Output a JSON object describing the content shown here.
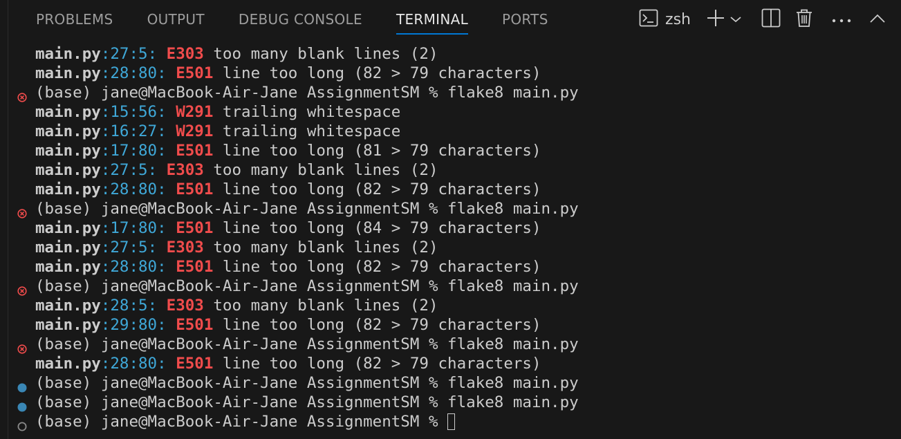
{
  "tabs": [
    {
      "label": "PROBLEMS",
      "active": false
    },
    {
      "label": "OUTPUT",
      "active": false
    },
    {
      "label": "DEBUG CONSOLE",
      "active": false
    },
    {
      "label": "TERMINAL",
      "active": true
    },
    {
      "label": "PORTS",
      "active": false
    }
  ],
  "actions": {
    "shell_label": "zsh",
    "icons": [
      "terminal-icon",
      "plus-icon",
      "chevron-down-icon",
      "split-icon",
      "trash-icon",
      "ellipsis-icon",
      "chevron-up-icon"
    ]
  },
  "colors": {
    "background": "#181818",
    "error_code": "#f14c4c",
    "location": "#3fa8d8",
    "tab_active_underline": "#0078d4",
    "decoration_error": "#f14c4c",
    "decoration_success": "#3a87b5",
    "decoration_default": "#8a8a8a"
  },
  "terminal": {
    "lines": [
      {
        "type": "lint",
        "file": "main.py",
        "loc": "27:5",
        "code": "E303",
        "msg": " too many blank lines (2)"
      },
      {
        "type": "lint",
        "file": "main.py",
        "loc": "28:80",
        "code": "E501",
        "msg": " line too long (82 > 79 characters)"
      },
      {
        "type": "prompt",
        "status": "error",
        "text": "(base) jane@MacBook-Air-Jane AssignmentSM % flake8 main.py"
      },
      {
        "type": "lint",
        "file": "main.py",
        "loc": "15:56",
        "code": "W291",
        "msg": " trailing whitespace"
      },
      {
        "type": "lint",
        "file": "main.py",
        "loc": "16:27",
        "code": "W291",
        "msg": " trailing whitespace"
      },
      {
        "type": "lint",
        "file": "main.py",
        "loc": "17:80",
        "code": "E501",
        "msg": " line too long (81 > 79 characters)"
      },
      {
        "type": "lint",
        "file": "main.py",
        "loc": "27:5",
        "code": "E303",
        "msg": " too many blank lines (2)"
      },
      {
        "type": "lint",
        "file": "main.py",
        "loc": "28:80",
        "code": "E501",
        "msg": " line too long (82 > 79 characters)"
      },
      {
        "type": "prompt",
        "status": "error",
        "text": "(base) jane@MacBook-Air-Jane AssignmentSM % flake8 main.py"
      },
      {
        "type": "lint",
        "file": "main.py",
        "loc": "17:80",
        "code": "E501",
        "msg": " line too long (84 > 79 characters)"
      },
      {
        "type": "lint",
        "file": "main.py",
        "loc": "27:5",
        "code": "E303",
        "msg": " too many blank lines (2)"
      },
      {
        "type": "lint",
        "file": "main.py",
        "loc": "28:80",
        "code": "E501",
        "msg": " line too long (82 > 79 characters)"
      },
      {
        "type": "prompt",
        "status": "error",
        "text": "(base) jane@MacBook-Air-Jane AssignmentSM % flake8 main.py"
      },
      {
        "type": "lint",
        "file": "main.py",
        "loc": "28:5",
        "code": "E303",
        "msg": " too many blank lines (2)"
      },
      {
        "type": "lint",
        "file": "main.py",
        "loc": "29:80",
        "code": "E501",
        "msg": " line too long (82 > 79 characters)"
      },
      {
        "type": "prompt",
        "status": "error",
        "text": "(base) jane@MacBook-Air-Jane AssignmentSM % flake8 main.py"
      },
      {
        "type": "lint",
        "file": "main.py",
        "loc": "28:80",
        "code": "E501",
        "msg": " line too long (82 > 79 characters)"
      },
      {
        "type": "prompt",
        "status": "success",
        "text": "(base) jane@MacBook-Air-Jane AssignmentSM % flake8 main.py"
      },
      {
        "type": "prompt",
        "status": "success",
        "text": "(base) jane@MacBook-Air-Jane AssignmentSM % flake8 main.py"
      },
      {
        "type": "prompt",
        "status": "pending",
        "text": "(base) jane@MacBook-Air-Jane AssignmentSM % ",
        "cursor": true
      }
    ]
  }
}
